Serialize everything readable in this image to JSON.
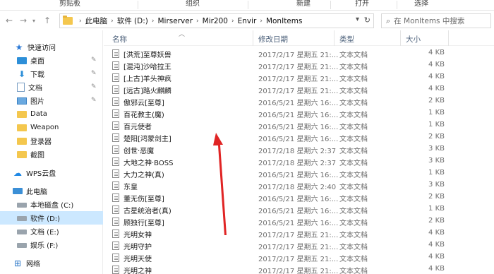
{
  "ribbon": {
    "groups": [
      "剪贴板",
      "组织",
      "新建",
      "打开",
      "选择"
    ]
  },
  "address": {
    "crumbs": [
      "此电脑",
      "软件 (D:)",
      "Mirserver",
      "Mir200",
      "Envir",
      "MonItems"
    ],
    "search_placeholder": "在 MonItems 中搜索"
  },
  "nav": {
    "items": [
      {
        "label": "快速访问",
        "icon": "star-icon"
      },
      {
        "label": "桌面",
        "icon": "desktop-icon",
        "pinned": true
      },
      {
        "label": "下载",
        "icon": "download-icon",
        "pinned": true
      },
      {
        "label": "文档",
        "icon": "document-icon",
        "pinned": true
      },
      {
        "label": "图片",
        "icon": "picture-icon",
        "pinned": true
      },
      {
        "label": "Data",
        "icon": "folder-icon"
      },
      {
        "label": "Weapon",
        "icon": "folder-icon"
      },
      {
        "label": "登录器",
        "icon": "folder-icon"
      },
      {
        "label": "截图",
        "icon": "folder-icon"
      },
      {
        "label": "WPS云盘",
        "icon": "cloud-icon"
      },
      {
        "label": "此电脑",
        "icon": "computer-icon"
      },
      {
        "label": "本地磁盘 (C:)",
        "icon": "drive-icon"
      },
      {
        "label": "软件 (D:)",
        "icon": "drive-icon",
        "selected": true
      },
      {
        "label": "文档 (E:)",
        "icon": "drive-icon"
      },
      {
        "label": "娱乐 (F:)",
        "icon": "drive-icon"
      },
      {
        "label": "网络",
        "icon": "network-icon"
      }
    ]
  },
  "columns": {
    "name": "名称",
    "date": "修改日期",
    "type": "类型",
    "size": "大小"
  },
  "files": [
    {
      "name": "[洪荒]至尊妖兽",
      "date": "2017/2/17 星期五 21:...",
      "type": "文本文档",
      "size": "4 KB"
    },
    {
      "name": "[混沌]沙哈拉王",
      "date": "2017/2/17 星期五 21:...",
      "type": "文本文档",
      "size": "4 KB"
    },
    {
      "name": "[上古]羊头神疯",
      "date": "2017/2/17 星期五 21:...",
      "type": "文本文档",
      "size": "4 KB"
    },
    {
      "name": "[远古]路火麒麟",
      "date": "2017/2/17 星期五 21:...",
      "type": "文本文档",
      "size": "4 KB"
    },
    {
      "name": "傲邪云[至尊]",
      "date": "2016/5/21 星期六 16:...",
      "type": "文本文档",
      "size": "2 KB"
    },
    {
      "name": "百花教主(魔)",
      "date": "2016/5/21 星期六 16:...",
      "type": "文本文档",
      "size": "1 KB"
    },
    {
      "name": "百元使者",
      "date": "2016/5/21 星期六 16:...",
      "type": "文本文档",
      "size": "1 KB"
    },
    {
      "name": "楚阳[鸿蒙剑主]",
      "date": "2016/5/21 星期六 16:...",
      "type": "文本文档",
      "size": "2 KB"
    },
    {
      "name": "创世·恶魔",
      "date": "2017/2/18 星期六 2:37",
      "type": "文本文档",
      "size": "3 KB"
    },
    {
      "name": "大地之神·BOSS",
      "date": "2017/2/18 星期六 2:37",
      "type": "文本文档",
      "size": "3 KB"
    },
    {
      "name": "大力之神(真)",
      "date": "2016/5/21 星期六 16:...",
      "type": "文本文档",
      "size": "1 KB"
    },
    {
      "name": "东皇",
      "date": "2017/2/18 星期六 2:40",
      "type": "文本文档",
      "size": "3 KB"
    },
    {
      "name": "董无伤[至尊]",
      "date": "2016/5/21 星期六 16:...",
      "type": "文本文档",
      "size": "2 KB"
    },
    {
      "name": "古星统治者(真)",
      "date": "2016/5/21 星期六 16:...",
      "type": "文本文档",
      "size": "1 KB"
    },
    {
      "name": "顾独行[至尊]",
      "date": "2016/5/21 星期六 16:...",
      "type": "文本文档",
      "size": "2 KB"
    },
    {
      "name": "光明女神",
      "date": "2017/2/17 星期五 21:...",
      "type": "文本文档",
      "size": "4 KB"
    },
    {
      "name": "光明守护",
      "date": "2017/2/17 星期五 21:...",
      "type": "文本文档",
      "size": "4 KB"
    },
    {
      "name": "光明天使",
      "date": "2017/2/17 星期五 21:...",
      "type": "文本文档",
      "size": "4 KB"
    },
    {
      "name": "光明之神",
      "date": "2017/2/17 星期五 21:...",
      "type": "文本文档",
      "size": "4 KB"
    }
  ],
  "colors": {
    "selected_bg": "#cce8ff",
    "annotation_arrow": "#e02424",
    "header_text": "#4c607a"
  }
}
